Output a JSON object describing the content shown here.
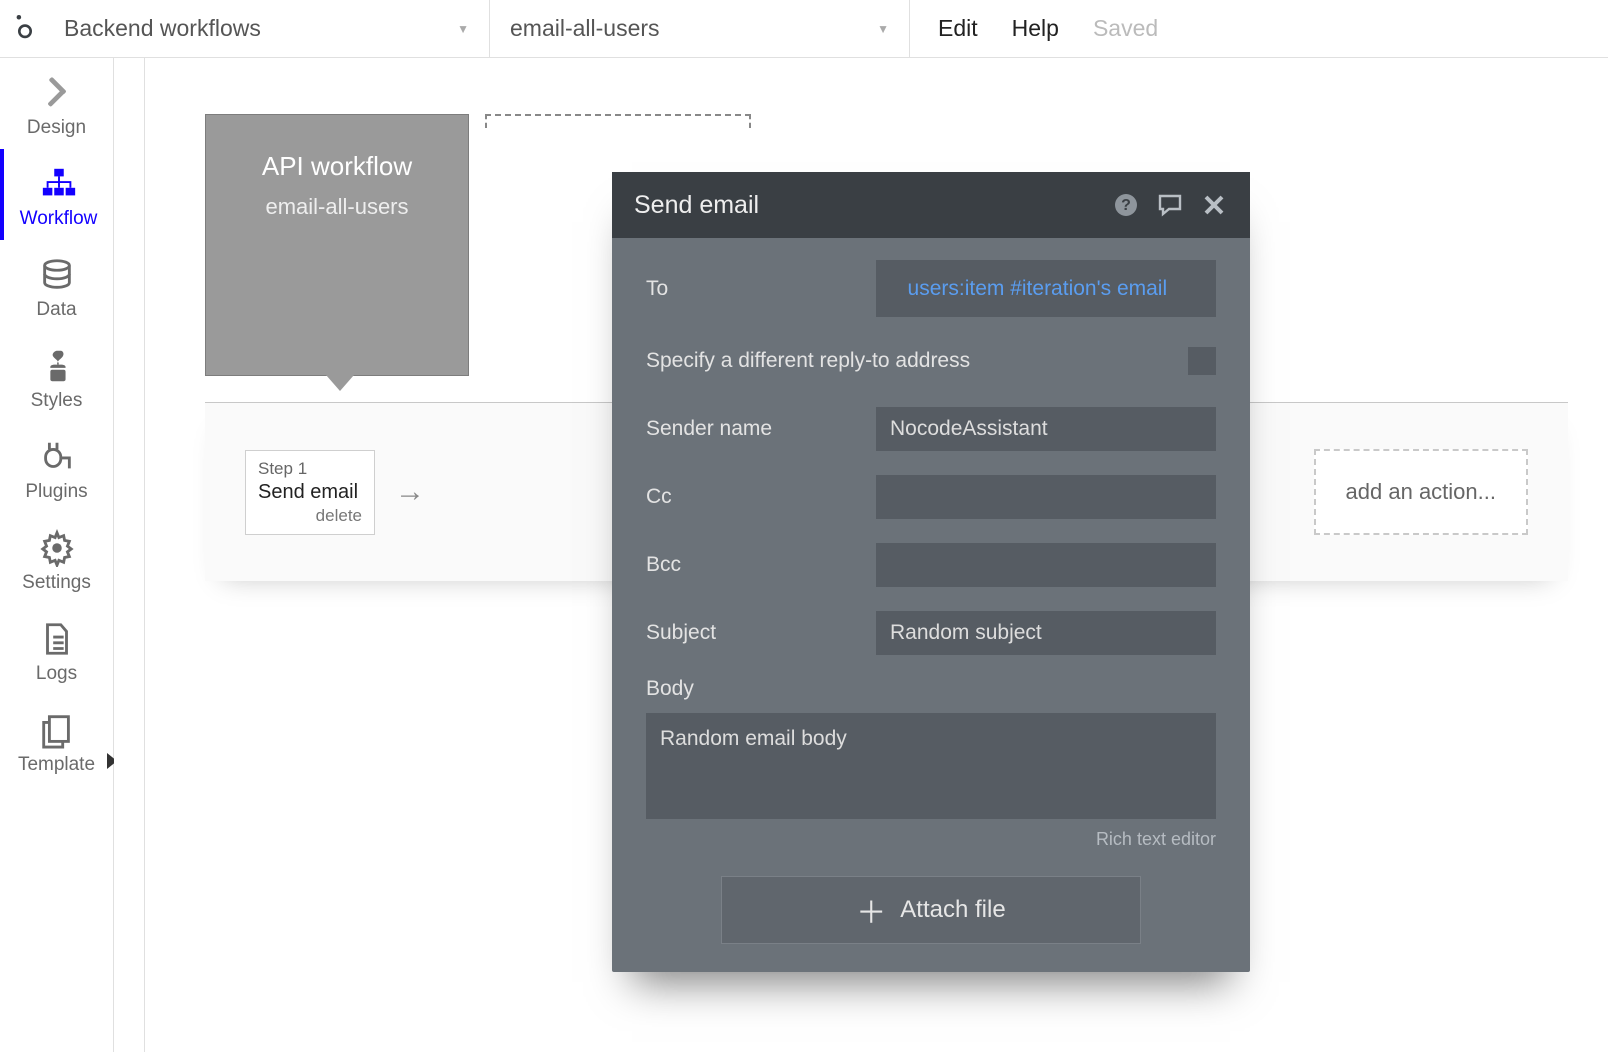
{
  "topbar": {
    "dropdown1_label": "Backend workflows",
    "dropdown2_label": "email-all-users",
    "edit_label": "Edit",
    "help_label": "Help",
    "saved_label": "Saved"
  },
  "sidebar": {
    "items": [
      {
        "id": "design",
        "label": "Design"
      },
      {
        "id": "workflow",
        "label": "Workflow"
      },
      {
        "id": "data",
        "label": "Data"
      },
      {
        "id": "styles",
        "label": "Styles"
      },
      {
        "id": "plugins",
        "label": "Plugins"
      },
      {
        "id": "settings",
        "label": "Settings"
      },
      {
        "id": "logs",
        "label": "Logs"
      },
      {
        "id": "template",
        "label": "Template"
      }
    ]
  },
  "workflow": {
    "card_title": "API workflow",
    "card_subtitle": "email-all-users",
    "step1_n": "Step 1",
    "step1_title": "Send email",
    "step1_delete": "delete",
    "add_action": "add an action..."
  },
  "panel": {
    "title": "Send email",
    "labels": {
      "to": "To",
      "reply_to": "Specify a different reply-to address",
      "sender": "Sender name",
      "cc": "Cc",
      "bcc": "Bcc",
      "subject": "Subject",
      "body": "Body",
      "rich_text": "Rich text editor",
      "attach": "Attach file"
    },
    "values": {
      "to_expression": "users:item #iteration's email",
      "sender_name": "NocodeAssistant",
      "cc": "",
      "bcc": "",
      "subject": "Random subject",
      "body": "Random email body"
    }
  }
}
